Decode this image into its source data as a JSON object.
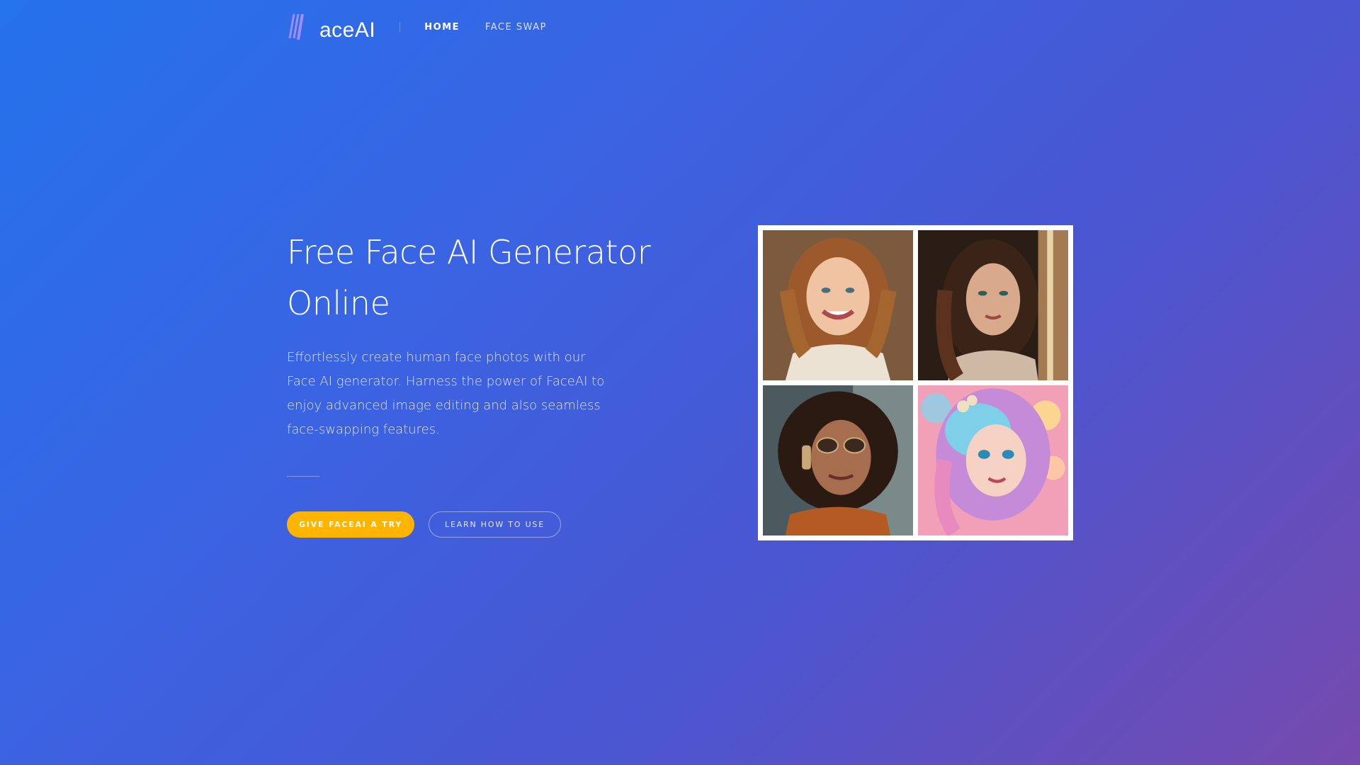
{
  "brand": {
    "logo_text": "aceAI",
    "logo_icon": "faceai-logo-icon"
  },
  "nav": {
    "items": [
      {
        "label": "HOME",
        "active": true
      },
      {
        "label": "FACE SWAP",
        "active": false
      }
    ]
  },
  "hero": {
    "title_line1": "Free Face AI Generator",
    "title_line2": "Online",
    "description": "Effortlessly create human face photos with our Face AI generator. Harness the power of FaceAI to enjoy advanced image editing and also seamless face-swapping features.",
    "primary_button": "GIVE FACEAI A TRY",
    "secondary_button": "LEARN HOW TO USE"
  },
  "gallery": {
    "images": [
      {
        "name": "smiling-woman-turtleneck-image"
      },
      {
        "name": "dark-hair-woman-window-image"
      },
      {
        "name": "curly-hair-woman-sunglasses-headphones-image"
      },
      {
        "name": "pastel-hair-animated-girl-image"
      }
    ]
  },
  "colors": {
    "primary_button": "#ffb400",
    "bg_start": "#2472ec",
    "bg_end": "#764aae"
  }
}
